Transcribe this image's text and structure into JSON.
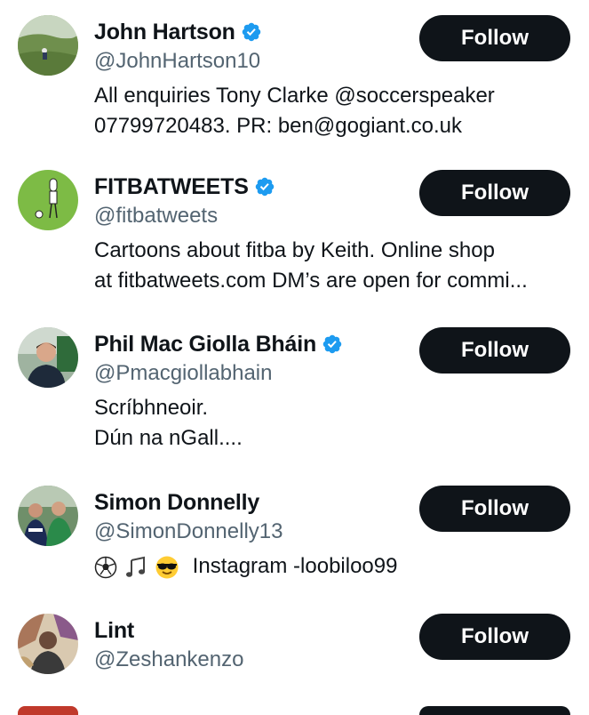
{
  "users": [
    {
      "name": "John Hartson",
      "verified": true,
      "handle": "@JohnHartson10",
      "bio_lines": [
        "All enquiries Tony Clarke @soccerspeaker",
        "07799720483. PR: ben@gogiant.co.uk"
      ],
      "follow_label": "Follow",
      "avatar_icon": "landscape-photo-avatar"
    },
    {
      "name": "FITBATWEETS",
      "verified": true,
      "handle": "@fitbatweets",
      "bio_lines": [
        "Cartoons about fitba by Keith. Online shop",
        "at fitbatweets.com DM’s are open for commi..."
      ],
      "follow_label": "Follow",
      "avatar_icon": "cartoon-figure-avatar"
    },
    {
      "name": "Phil Mac Giolla Bháin",
      "verified": true,
      "handle": "@Pmacgiollabhain",
      "bio_lines": [
        "Scríbhneoir.",
        "Dún na nGall...."
      ],
      "follow_label": "Follow",
      "avatar_icon": "man-photo-avatar"
    },
    {
      "name": "Simon Donnelly",
      "verified": false,
      "handle": "@SimonDonnelly13",
      "bio_text": "Instagram -loobiloo99",
      "bio_emojis": [
        "soccer-ball-emoji",
        "music-note-emoji",
        "sunglasses-emoji"
      ],
      "follow_label": "Follow",
      "avatar_icon": "group-photo-avatar"
    },
    {
      "name": "Lint",
      "verified": false,
      "handle": "@Zeshankenzo",
      "bio_lines": [],
      "follow_label": "Follow",
      "avatar_icon": "artwork-avatar"
    }
  ],
  "colors": {
    "text": "#0f1419",
    "secondary": "#536471",
    "verified": "#1d9bf0",
    "follow_bg": "#0f1419",
    "follow_text": "#ffffff"
  }
}
